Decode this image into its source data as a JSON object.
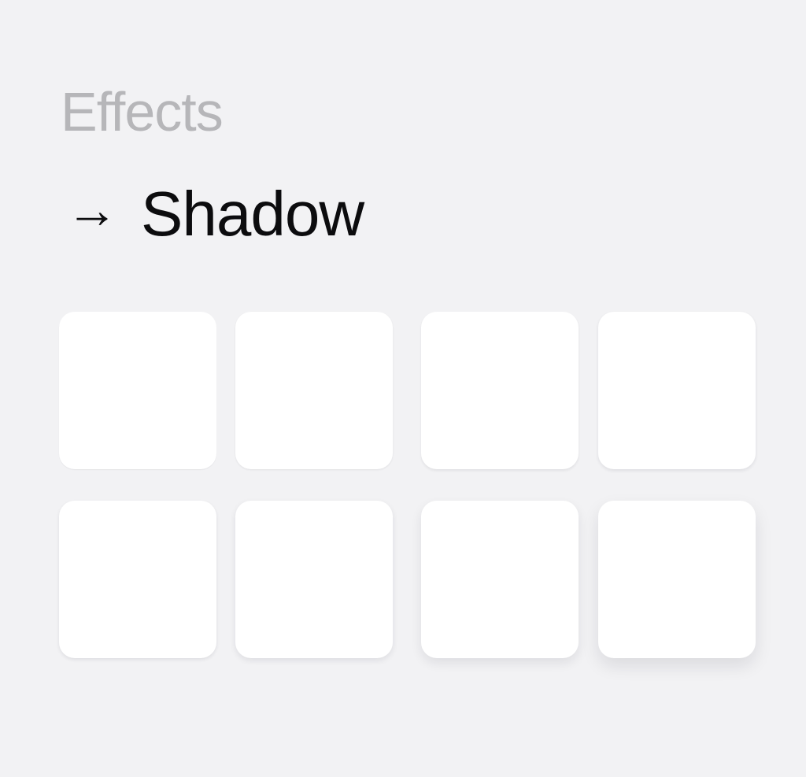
{
  "header": {
    "category": "Effects",
    "arrow": "→",
    "title": "Shadow"
  },
  "colors": {
    "background": "#f2f2f4",
    "category_text": "#b6b6b9",
    "title_text": "#0c0c0e",
    "tile": "#ffffff"
  },
  "tiles": [
    {
      "shadow_level": 1
    },
    {
      "shadow_level": 2
    },
    {
      "shadow_level": 3
    },
    {
      "shadow_level": 4
    },
    {
      "shadow_level": 5
    },
    {
      "shadow_level": 6
    },
    {
      "shadow_level": 7
    },
    {
      "shadow_level": 8
    }
  ]
}
